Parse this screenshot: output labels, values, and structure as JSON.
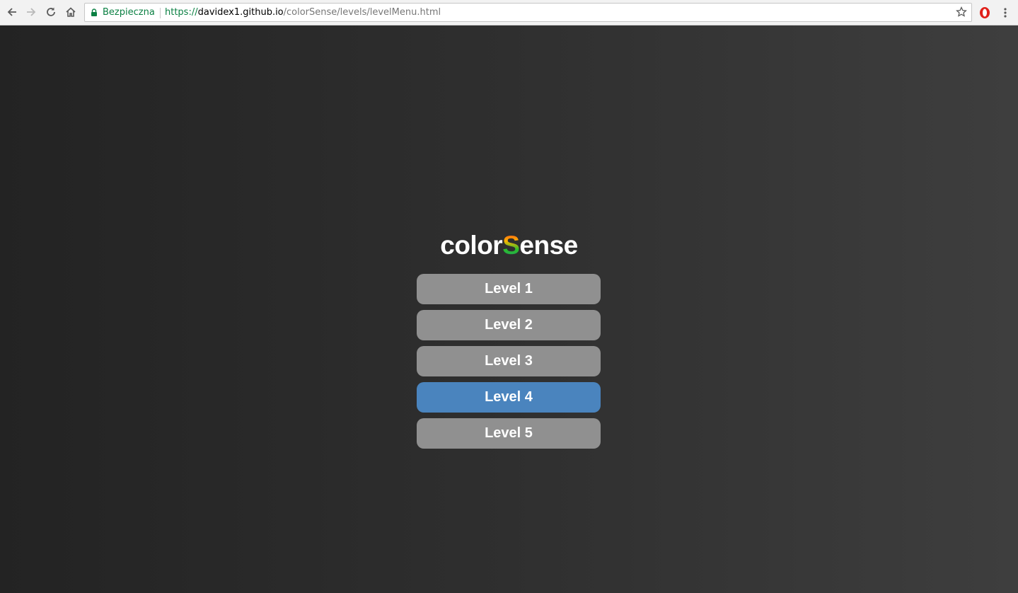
{
  "browser": {
    "secure_label": "Bezpieczna",
    "url_scheme": "https://",
    "url_host": "davidex1.github.io",
    "url_path": "/colorSense/levels/levelMenu.html",
    "icons": [
      "back-arrow-icon",
      "forward-arrow-icon",
      "reload-icon",
      "home-icon",
      "lock-icon",
      "star-icon",
      "opera-icon",
      "more-vert-icon"
    ]
  },
  "app": {
    "title_prefix": "color",
    "title_highlight": "S",
    "title_suffix": "ense",
    "levels": [
      {
        "label": "Level 1",
        "active": false
      },
      {
        "label": "Level 2",
        "active": false
      },
      {
        "label": "Level 3",
        "active": false
      },
      {
        "label": "Level 4",
        "active": true
      },
      {
        "label": "Level 5",
        "active": false
      }
    ]
  },
  "colors": {
    "button_default": "#909090",
    "button_active": "#4a84be",
    "secure_green": "#0b8043"
  }
}
